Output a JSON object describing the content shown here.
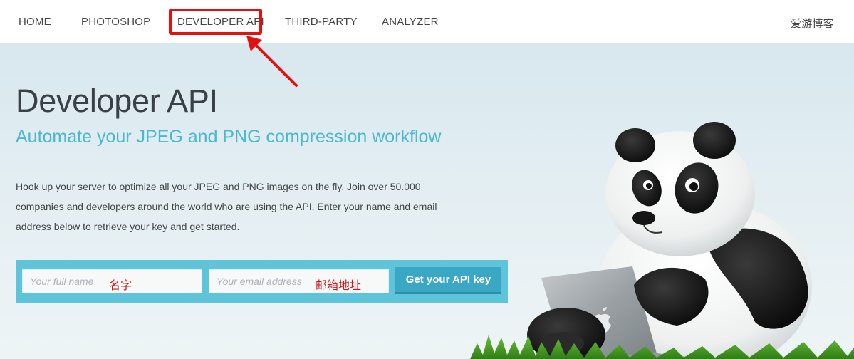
{
  "nav": {
    "items": [
      {
        "label": "HOME"
      },
      {
        "label": "PHOTOSHOP"
      },
      {
        "label": "DEVELOPER API"
      },
      {
        "label": "THIRD-PARTY"
      },
      {
        "label": "ANALYZER"
      }
    ],
    "blog_link": "爱游博客",
    "highlight_color": "#e31010"
  },
  "hero": {
    "title": "Developer API",
    "subtitle": "Automate your JPEG and PNG compression workflow",
    "description": "Hook up your server to optimize all your JPEG and PNG images on the fly. Join over 50.000 companies and developers around the world who are using the API. Enter your name and email address below to retrieve your key and get started."
  },
  "form": {
    "name_placeholder": "Your full name",
    "name_annotation": "名字",
    "email_placeholder": "Your email address",
    "email_annotation": "邮箱地址",
    "submit_label": "Get your API key"
  },
  "colors": {
    "accent": "#4bb8cf",
    "form_band": "#5ec4da",
    "button": "#3aa8c5",
    "annotation": "#d01818"
  },
  "illustration": {
    "subject": "panda-with-laptop",
    "laptop_logo": "apple-logo-icon"
  }
}
